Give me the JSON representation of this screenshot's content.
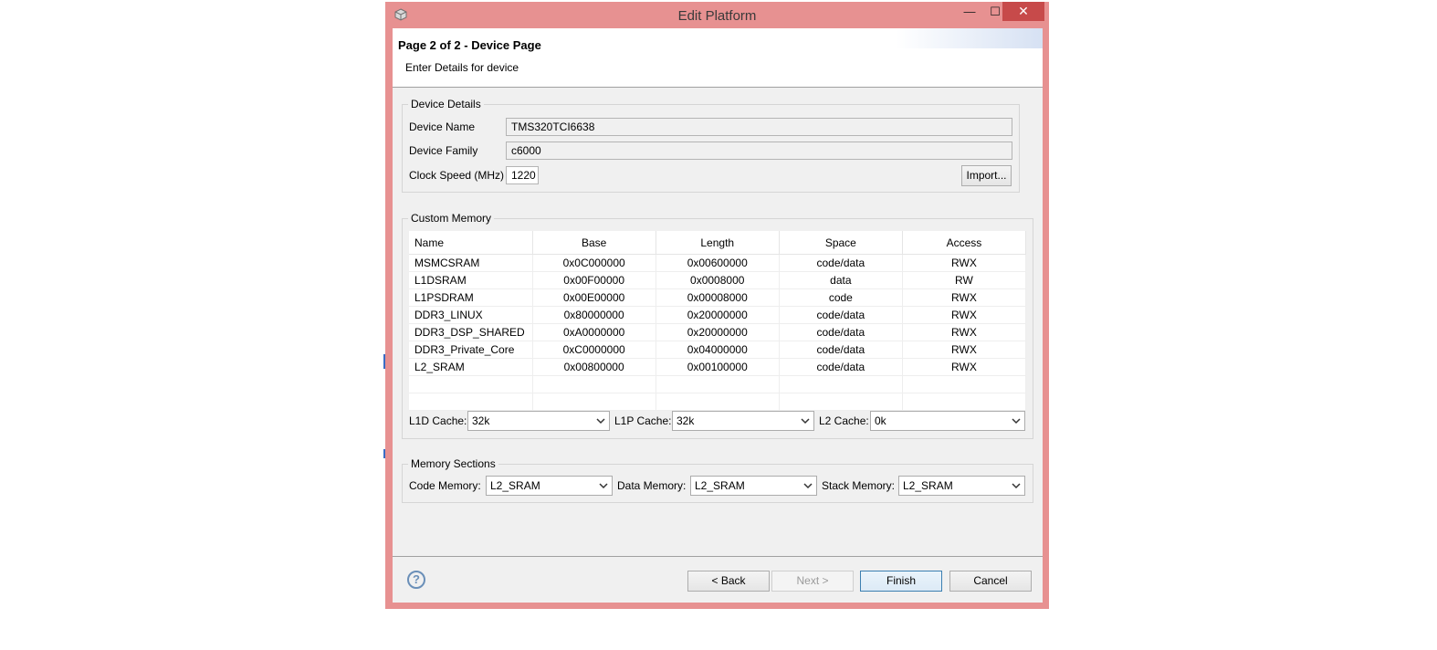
{
  "window": {
    "title": "Edit Platform",
    "minimize_glyph": "—",
    "maximize_glyph": "☐",
    "close_glyph": "✕"
  },
  "banner": {
    "title": "Page 2 of 2 - Device Page",
    "description": "Enter Details for device"
  },
  "device_details": {
    "group_label": "Device Details",
    "name_label": "Device Name",
    "name_value": "TMS320TCI6638",
    "family_label": "Device Family",
    "family_value": "c6000",
    "clock_label": "Clock Speed (MHz)",
    "clock_value": "1220",
    "import_label": "Import..."
  },
  "custom_memory": {
    "group_label": "Custom Memory",
    "columns": [
      "Name",
      "Base",
      "Length",
      "Space",
      "Access"
    ],
    "rows": [
      [
        "MSMCSRAM",
        "0x0C000000",
        "0x00600000",
        "code/data",
        "RWX"
      ],
      [
        "L1DSRAM",
        "0x00F00000",
        "0x0008000",
        "data",
        "RW"
      ],
      [
        "L1PSDRAM",
        "0x00E00000",
        "0x00008000",
        "code",
        "RWX"
      ],
      [
        "DDR3_LINUX",
        "0x80000000",
        "0x20000000",
        "code/data",
        "RWX"
      ],
      [
        "DDR3_DSP_SHARED",
        "0xA0000000",
        "0x20000000",
        "code/data",
        "RWX"
      ],
      [
        "DDR3_Private_Core",
        "0xC0000000",
        "0x04000000",
        "code/data",
        "RWX"
      ],
      [
        "L2_SRAM",
        "0x00800000",
        "0x00100000",
        "code/data",
        "RWX"
      ]
    ],
    "l1d_label": "L1D Cache:",
    "l1d_value": "32k",
    "l1p_label": "L1P Cache:",
    "l1p_value": "32k",
    "l2_label": "L2 Cache:",
    "l2_value": "0k"
  },
  "memory_sections": {
    "group_label": "Memory Sections",
    "code_label": "Code Memory:",
    "code_value": "L2_SRAM",
    "data_label": "Data Memory:",
    "data_value": "L2_SRAM",
    "stack_label": "Stack Memory:",
    "stack_value": "L2_SRAM"
  },
  "footer": {
    "help_glyph": "?",
    "back_label": "< Back",
    "next_label": "Next >",
    "finish_label": "Finish",
    "cancel_label": "Cancel"
  },
  "colors": {
    "frame": "#e79191",
    "close_button": "#c74a4a",
    "panel": "#f0f0f0"
  },
  "icons": [
    "app-icon",
    "help-icon",
    "chevron-down-icon"
  ]
}
